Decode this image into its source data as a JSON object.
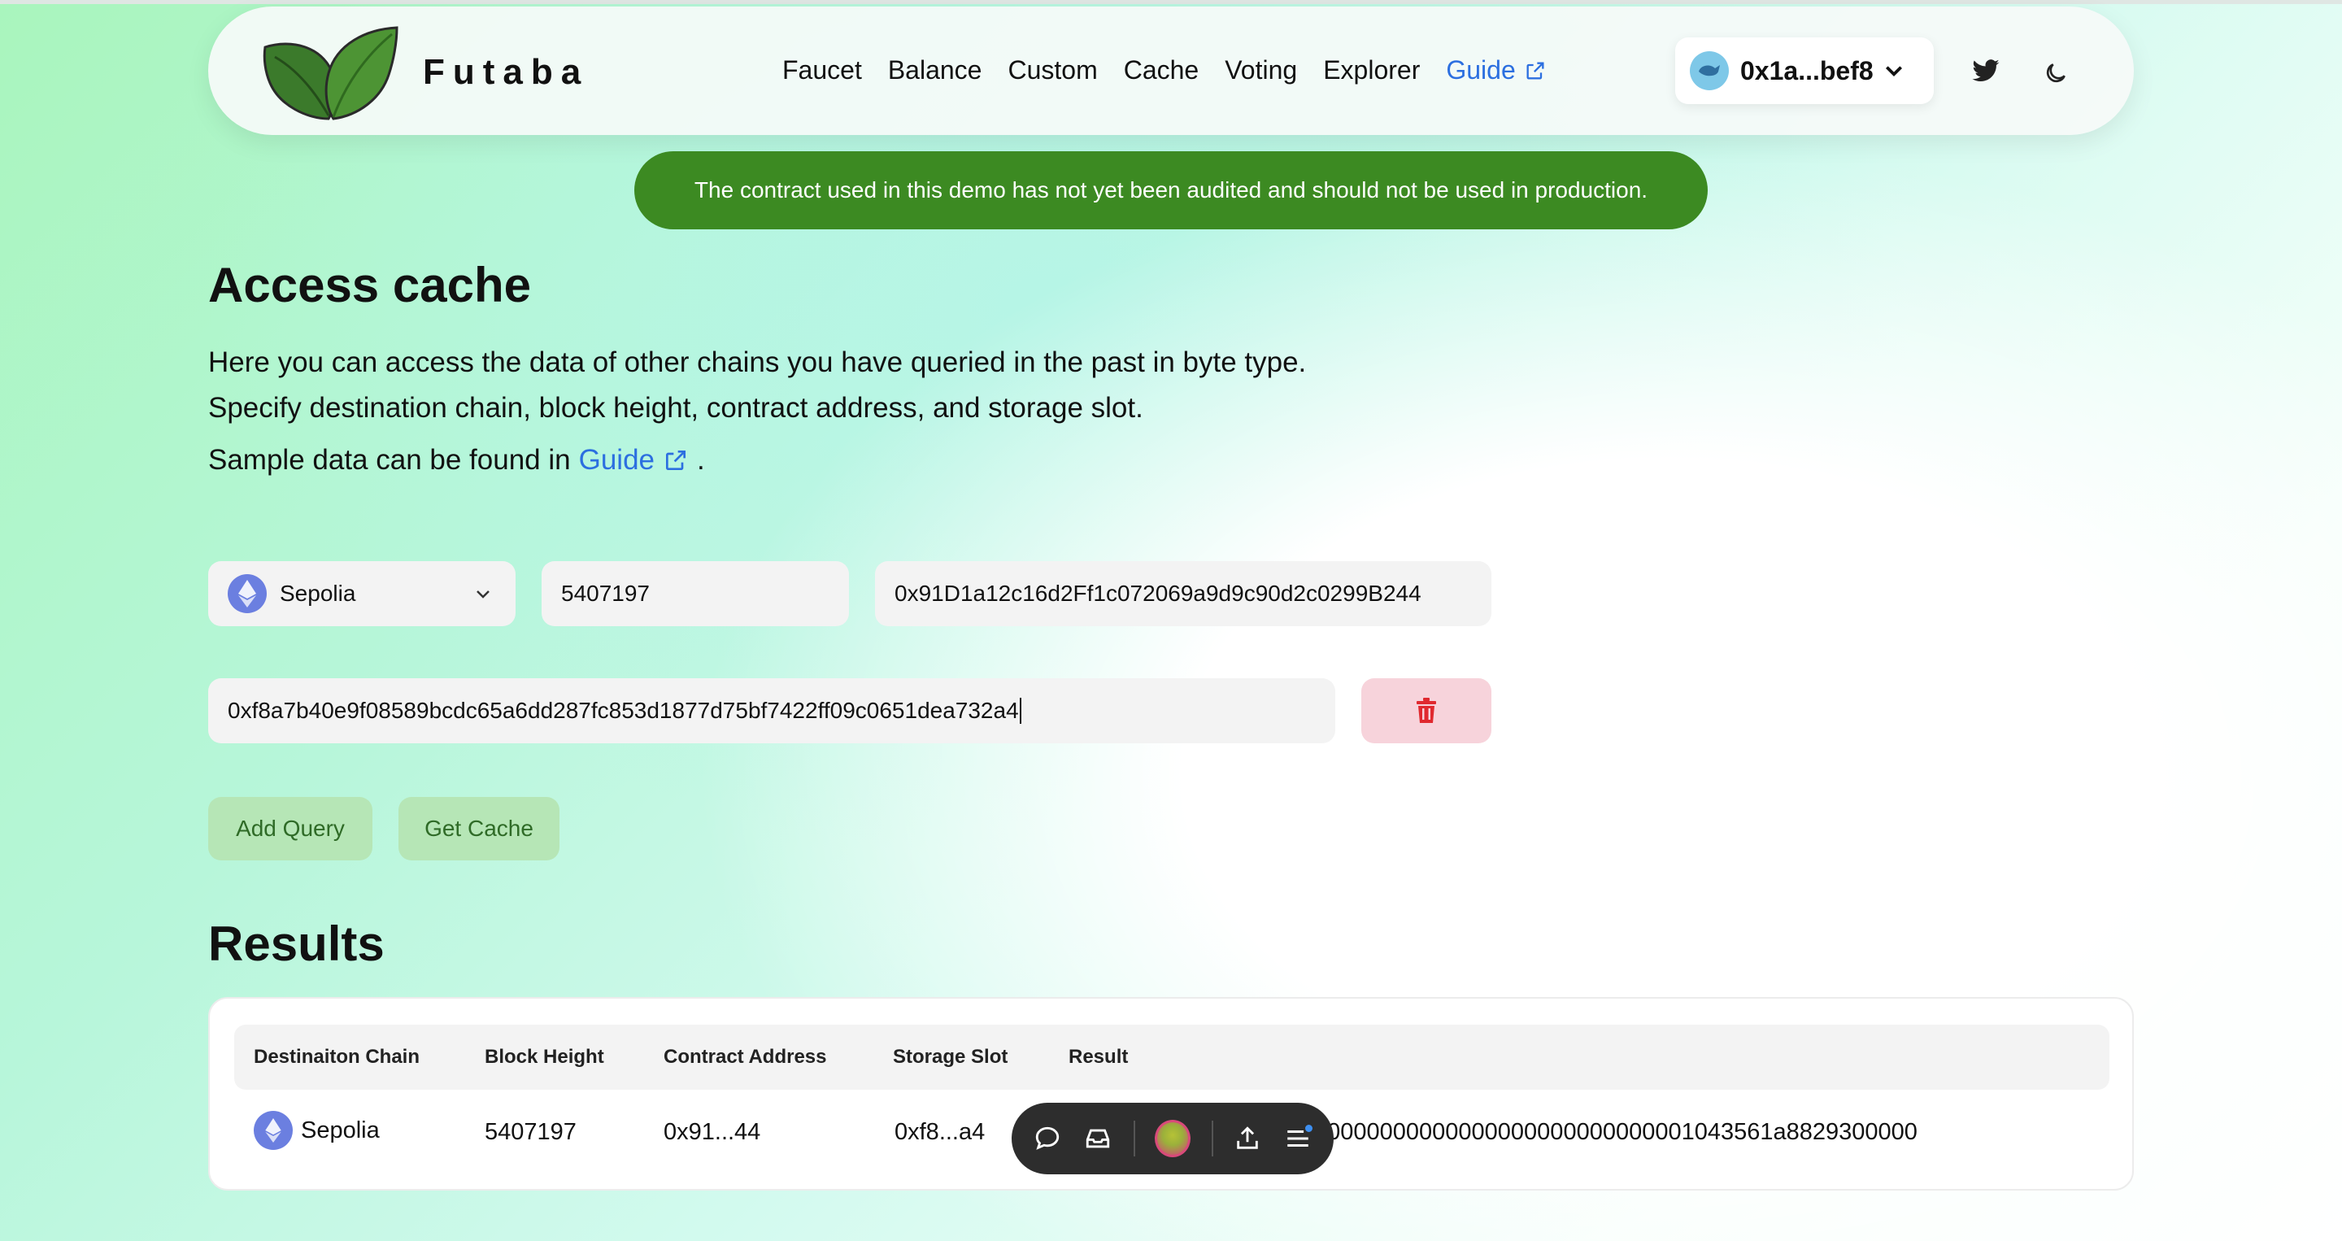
{
  "header": {
    "brand": "Futaba",
    "nav": [
      {
        "label": "Faucet"
      },
      {
        "label": "Balance"
      },
      {
        "label": "Custom"
      },
      {
        "label": "Cache"
      },
      {
        "label": "Voting"
      },
      {
        "label": "Explorer"
      },
      {
        "label": "Guide"
      }
    ],
    "wallet_address": "0x1a...bef8",
    "accent_color": "#2c6fe0"
  },
  "banner": {
    "text": "The contract used in this demo has not yet been audited and should not be used in production.",
    "color": "#3c8a22"
  },
  "page": {
    "title": "Access cache",
    "description_line1": "Here you can access the data of other chains you have queried in the past in byte type.",
    "description_line2": "Specify destination chain, block height, contract address, and storage slot.",
    "sample_prefix": "Sample data can be found in",
    "sample_link": "Guide",
    "sample_suffix": "."
  },
  "form": {
    "chain": "Sepolia",
    "block_height": "5407197",
    "contract_address": "0x91D1a12c16d2Ff1c072069a9d9c90d2c0299B244",
    "storage_slot": "0xf8a7b40e9f08589bcdc65a6dd287fc853d1877d75bf7422ff09c0651dea732a4",
    "add_query_label": "Add Query",
    "get_cache_label": "Get Cache"
  },
  "results": {
    "title": "Results",
    "columns": [
      "Destinaiton Chain",
      "Block Height",
      "Contract Address",
      "Storage Slot",
      "Result"
    ],
    "rows": [
      {
        "chain": "Sepolia",
        "block_height": "5407197",
        "contract_address": "0x91...44",
        "storage_slot": "0xf8...a4",
        "result": "00000000000000000000000000001043561a8829300000"
      }
    ]
  },
  "icons": {
    "twitter": "twitter-icon",
    "theme": "moon-icon",
    "delete": "trash-icon",
    "chat": "chat-bubble-icon",
    "inbox": "inbox-icon",
    "share": "share-icon",
    "menu": "menu-icon"
  }
}
